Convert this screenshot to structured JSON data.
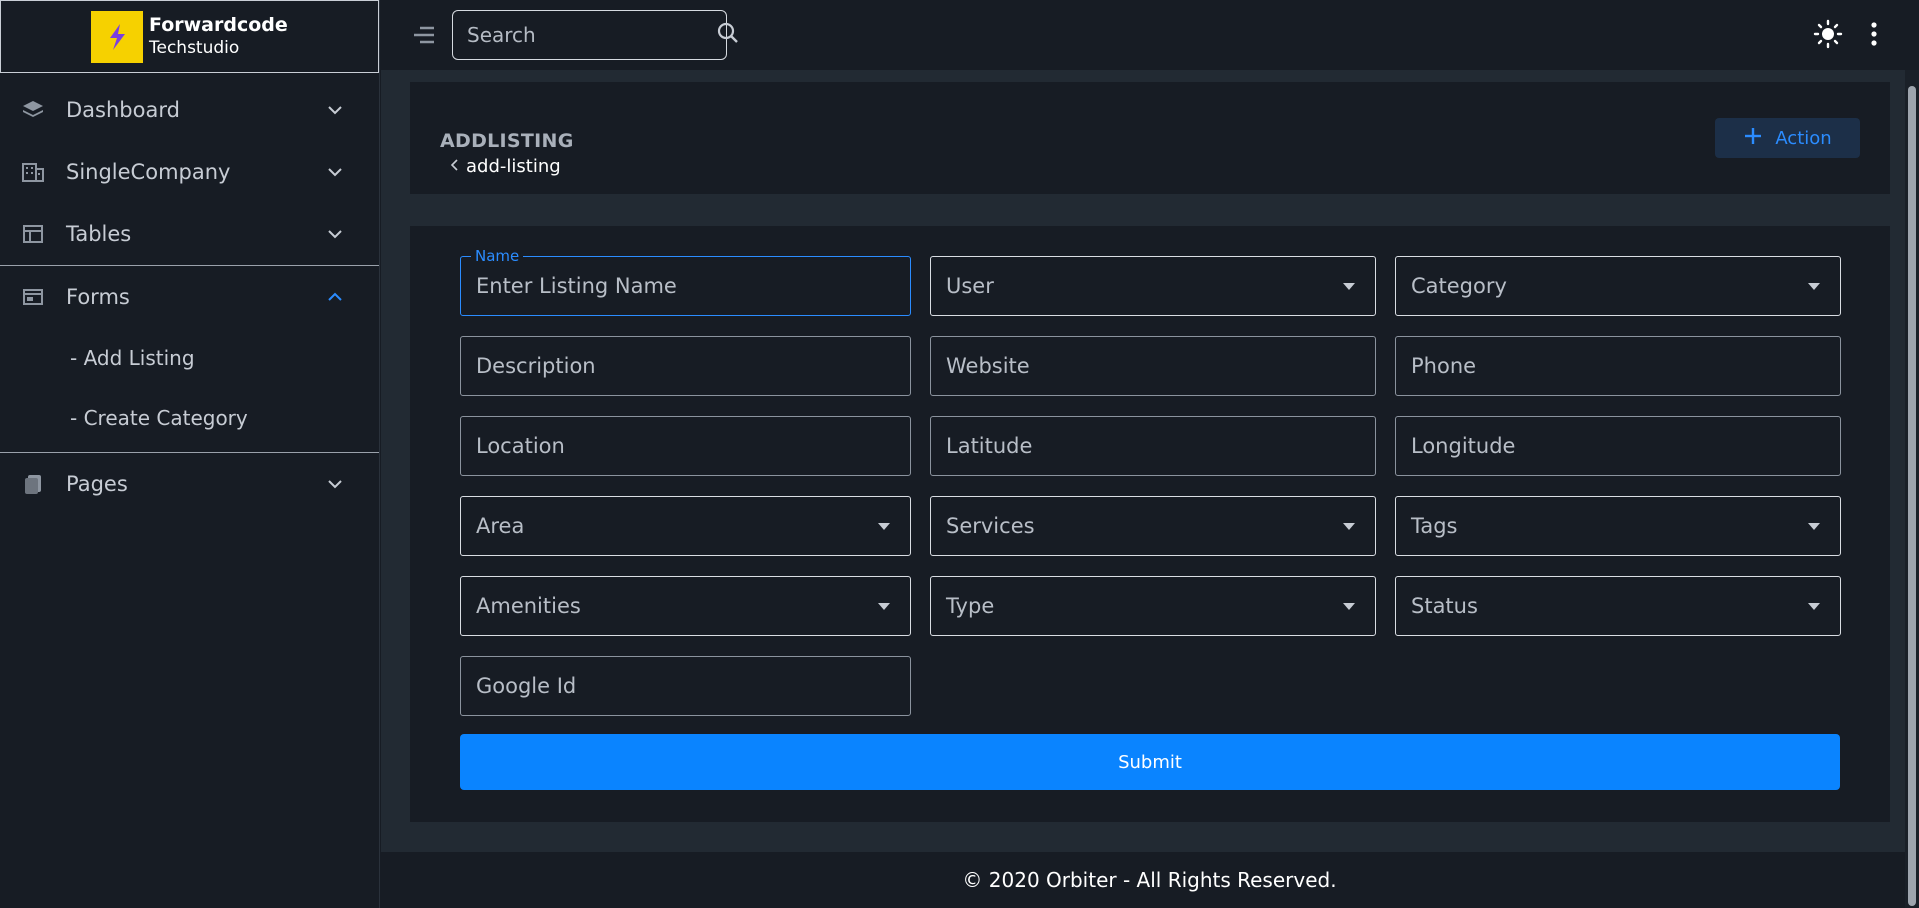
{
  "brand": {
    "title": "Forwardcode",
    "subtitle": "Techstudio",
    "logo_color": "#f6d100",
    "logo_icon": "bolt-icon"
  },
  "sidebar": {
    "items": [
      {
        "label": "Dashboard",
        "icon": "layers-icon"
      },
      {
        "label": "SingleCompany",
        "icon": "building-icon"
      },
      {
        "label": "Tables",
        "icon": "table-icon"
      },
      {
        "label": "Forms",
        "icon": "form-icon",
        "expanded": true
      },
      {
        "label": "Pages",
        "icon": "document-icon"
      }
    ],
    "forms_sub": [
      "- Add Listing",
      "- Create Category"
    ]
  },
  "topbar": {
    "search_placeholder": "Search"
  },
  "header": {
    "title": "ADDLISTING",
    "breadcrumb": "add-listing",
    "action_label": "Action"
  },
  "form": {
    "name_label": "Name",
    "name_placeholder": "Enter Listing Name",
    "user": "User",
    "category": "Category",
    "description": "Description",
    "website": "Website",
    "phone": "Phone",
    "location": "Location",
    "latitude": "Latitude",
    "longitude": "Longitude",
    "area": "Area",
    "services": "Services",
    "tags": "Tags",
    "amenities": "Amenities",
    "type": "Type",
    "status": "Status",
    "google_id": "Google Id",
    "submit": "Submit"
  },
  "footer": {
    "text": "© 2020 Orbiter - All Rights Reserved."
  },
  "colors": {
    "accent": "#0a84ff",
    "background": "#171c24",
    "panel": "#222a33"
  }
}
